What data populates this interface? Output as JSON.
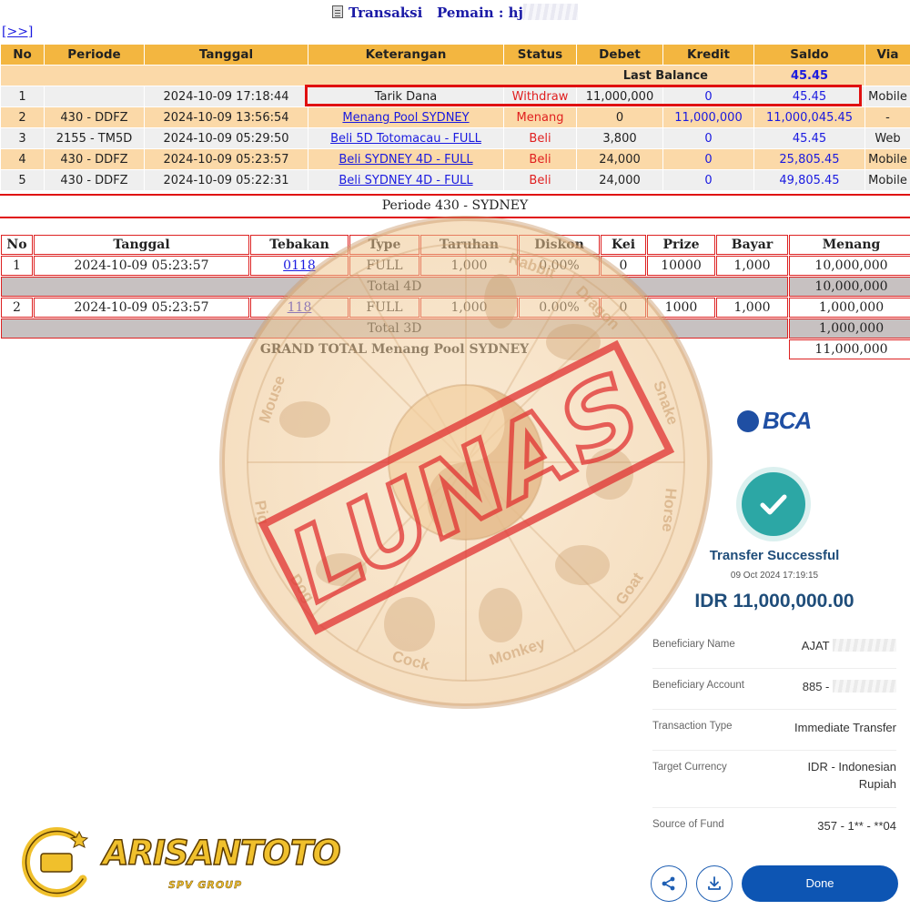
{
  "header": {
    "title": "Transaksi",
    "player_label": "Pemain :",
    "player_name": "hj",
    "nav_link": "[>>]"
  },
  "transactions": {
    "columns": [
      "No",
      "Periode",
      "Tanggal",
      "Keterangan",
      "Status",
      "Debet",
      "Kredit",
      "Saldo",
      "Via"
    ],
    "last_balance_label": "Last Balance",
    "last_balance_value": "45.45",
    "rows": [
      {
        "no": "1",
        "periode": "",
        "tanggal": "2024-10-09 17:18:44",
        "keterangan": "Tarik Dana",
        "status": "Withdraw",
        "debet": "11,000,000",
        "kredit": "0",
        "saldo": "45.45",
        "via": "Mobile"
      },
      {
        "no": "2",
        "periode": "430 - DDFZ",
        "tanggal": "2024-10-09 13:56:54",
        "keterangan": "Menang Pool SYDNEY",
        "status": "Menang",
        "debet": "0",
        "kredit": "11,000,000",
        "saldo": "11,000,045.45",
        "via": "-"
      },
      {
        "no": "3",
        "periode": "2155 - TM5D",
        "tanggal": "2024-10-09 05:29:50",
        "keterangan": "Beli 5D Totomacau - FULL",
        "status": "Beli",
        "debet": "3,800",
        "kredit": "0",
        "saldo": "45.45",
        "via": "Web"
      },
      {
        "no": "4",
        "periode": "430 - DDFZ",
        "tanggal": "2024-10-09 05:23:57",
        "keterangan": "Beli SYDNEY 4D - FULL",
        "status": "Beli",
        "debet": "24,000",
        "kredit": "0",
        "saldo": "25,805.45",
        "via": "Mobile"
      },
      {
        "no": "5",
        "periode": "430 - DDFZ",
        "tanggal": "2024-10-09 05:22:31",
        "keterangan": "Beli SYDNEY 4D - FULL",
        "status": "Beli",
        "debet": "24,000",
        "kredit": "0",
        "saldo": "49,805.45",
        "via": "Mobile"
      }
    ]
  },
  "periode": {
    "title": "Periode 430 - SYDNEY",
    "columns": [
      "No",
      "Tanggal",
      "Tebakan",
      "Type",
      "Taruhan",
      "Diskon",
      "Kei",
      "Prize",
      "Bayar",
      "Menang"
    ],
    "rows": [
      {
        "no": "1",
        "tanggal": "2024-10-09 05:23:57",
        "tebakan": "0118",
        "type": "FULL",
        "taruhan": "1,000",
        "diskon": "0.00%",
        "kei": "0",
        "prize": "10000",
        "bayar": "1,000",
        "menang": "10,000,000"
      },
      {
        "no": "2",
        "tanggal": "2024-10-09 05:23:57",
        "tebakan": "118",
        "type": "FULL",
        "taruhan": "1,000",
        "diskon": "0.00%",
        "kei": "0",
        "prize": "1000",
        "bayar": "1,000",
        "menang": "1,000,000"
      }
    ],
    "total_4d_label": "Total 4D",
    "total_4d_value": "10,000,000",
    "total_3d_label": "Total 3D",
    "total_3d_value": "1,000,000",
    "grand_total_label": "GRAND TOTAL  Menang Pool SYDNEY",
    "grand_total_value": "11,000,000"
  },
  "watermark": {
    "stamp_text": "LUNAS",
    "zodiac_labels": [
      "Rabbit",
      "Dragon",
      "Snake",
      "Horse",
      "Goat",
      "Monkey",
      "Cock",
      "Dog",
      "Pig",
      "Mouse"
    ]
  },
  "receipt": {
    "bank_logo": "BCA",
    "status_title": "Transfer Successful",
    "datetime": "09 Oct 2024 17:19:15",
    "amount": "IDR 11,000,000.00",
    "fields": [
      {
        "label": "Beneficiary Name",
        "value": "AJAT"
      },
      {
        "label": "Beneficiary Account",
        "value": "885 -"
      },
      {
        "label": "Transaction Type",
        "value": "Immediate Transfer"
      },
      {
        "label": "Target Currency",
        "value": "IDR - Indonesian Rupiah"
      },
      {
        "label": "Source of Fund",
        "value": "357 - 1** - **04"
      }
    ],
    "done_label": "Done",
    "share_icon": "share-icon",
    "download_icon": "download-icon"
  },
  "brand": {
    "name": "ARISANTOTO",
    "subtitle": "SPV GROUP"
  },
  "colors": {
    "header_orange": "#f3b640",
    "row_peach": "#fbd9a8",
    "row_grey": "#efefef",
    "link_blue": "#1a1ae0",
    "status_red": "#e01f1f",
    "bca_blue": "#1f4fa3",
    "success_teal": "#2ca7a5",
    "stamp_red": "#e03030"
  }
}
